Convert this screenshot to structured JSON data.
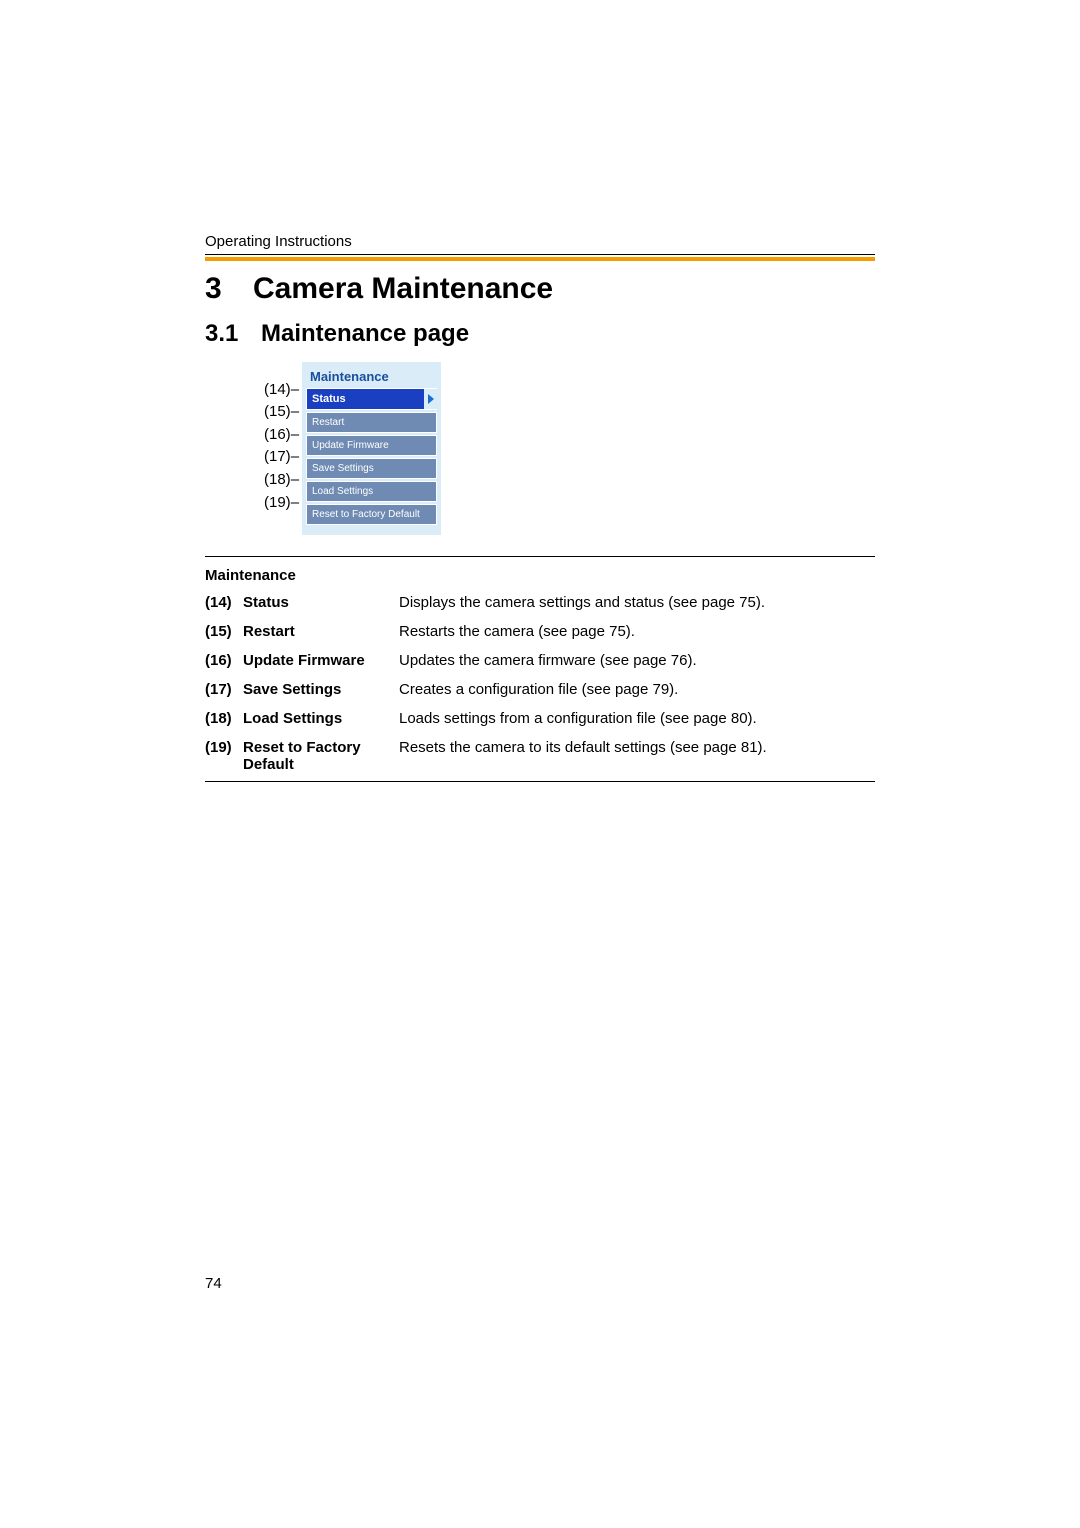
{
  "header": "Operating Instructions",
  "chapter": {
    "num": "3",
    "title": "Camera Maintenance"
  },
  "section": {
    "num": "3.1",
    "title": "Maintenance page"
  },
  "menu": {
    "title": "Maintenance",
    "items": [
      {
        "callout": "(14)",
        "label": "Status",
        "selected": true
      },
      {
        "callout": "(15)",
        "label": "Restart",
        "selected": false
      },
      {
        "callout": "(16)",
        "label": "Update Firmware",
        "selected": false
      },
      {
        "callout": "(17)",
        "label": "Save Settings",
        "selected": false
      },
      {
        "callout": "(18)",
        "label": "Load Settings",
        "selected": false
      },
      {
        "callout": "(19)",
        "label": "Reset to Factory Default",
        "selected": false
      }
    ]
  },
  "table": {
    "title": "Maintenance",
    "rows": [
      {
        "num": "(14)",
        "label": "Status",
        "desc": "Displays the camera settings and status (see page 75)."
      },
      {
        "num": "(15)",
        "label": "Restart",
        "desc": "Restarts the camera (see page 75)."
      },
      {
        "num": "(16)",
        "label": "Update Firmware",
        "desc": "Updates the camera firmware (see page 76)."
      },
      {
        "num": "(17)",
        "label": "Save Settings",
        "desc": "Creates a configuration file (see page 79)."
      },
      {
        "num": "(18)",
        "label": "Load Settings",
        "desc": "Loads settings from a configuration file (see page 80)."
      },
      {
        "num": "(19)",
        "label": "Reset to Factory Default",
        "desc": "Resets the camera to its default settings (see page 81)."
      }
    ]
  },
  "page_number": "74"
}
